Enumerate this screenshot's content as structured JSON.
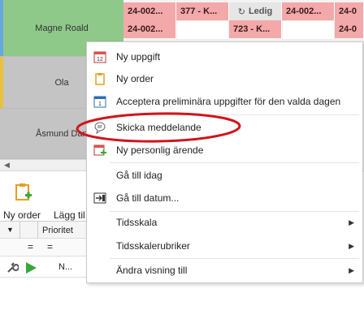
{
  "resources": [
    {
      "name": "Magne Roald",
      "bg": "#8fc98a",
      "strip": "#6aa6e0"
    },
    {
      "name": "Ola",
      "bg": "#c4c4c4",
      "strip": "#e8c23a"
    },
    {
      "name": "Åsmund Dan",
      "bg": "#c4c4c4",
      "strip": "#c4c4c4"
    }
  ],
  "calendar": {
    "row1": [
      "24-002...",
      "377 - K...",
      "Ledig",
      "24-002...",
      "24-0"
    ],
    "row2": [
      "24-002...",
      "",
      "723 - K...",
      "",
      "24-0"
    ]
  },
  "toolbar": {
    "new_order": "Ny order",
    "add": "Lägg til"
  },
  "grid": {
    "priority_header": "Prioritet",
    "filter_eq1": "=",
    "filter_eq2": "=",
    "row_value": "N..."
  },
  "context_menu": {
    "items": [
      {
        "label": "Ny uppgift",
        "icon": "calendar-icon"
      },
      {
        "label": "Ny order",
        "icon": "clipboard-icon"
      },
      {
        "label": "Acceptera preliminära uppgifter för den valda dagen",
        "icon": "calendar-accept-icon"
      },
      {
        "label": "Skicka meddelande",
        "icon": "chat-bubble-icon"
      },
      {
        "label": "Ny personlig ärende",
        "icon": "calendar-add-icon"
      },
      {
        "label": "Gå till idag",
        "icon": ""
      },
      {
        "label": "Gå till datum...",
        "icon": "goto-date-icon"
      },
      {
        "label": "Tidsskala",
        "icon": ""
      },
      {
        "label": "Tidsskalerubriker",
        "icon": ""
      },
      {
        "label": "Ändra visning till",
        "icon": ""
      }
    ]
  },
  "colors": {
    "task_pink": "#f3a9a9",
    "highlight_ellipse": "#d0141c",
    "menu_border": "#c9c9c9"
  }
}
